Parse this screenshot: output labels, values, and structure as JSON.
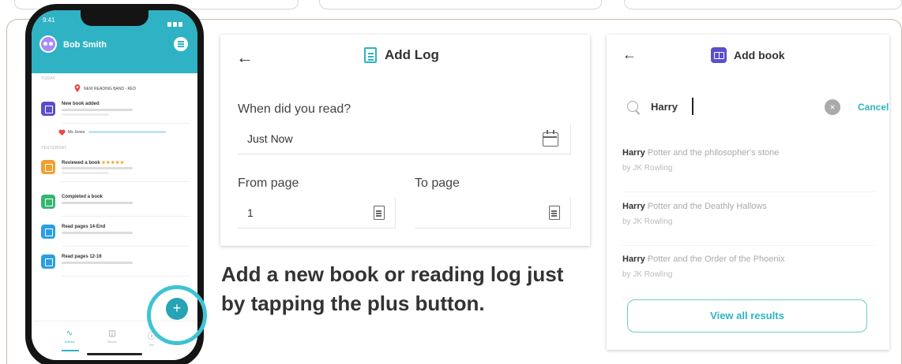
{
  "colors": {
    "teal": "#2fb3c4",
    "purple": "#5b4fc9",
    "fab_ring": "#3fc3d3"
  },
  "phone": {
    "status_time": "9:41",
    "user_name": "Bob Smith",
    "section_today": "TODAY",
    "note_milestone": "NEW READING BAND - RED",
    "items_today": [
      {
        "title": "New book added",
        "icon": "book-icon",
        "color": "#5b4fc9"
      }
    ],
    "note_heart": "Ms Jones",
    "section_yesterday": "YESTERDAY",
    "items_yesterday": [
      {
        "title": "Reviewed a book",
        "stars": "★★★★★",
        "icon": "star-badge-icon",
        "color": "#f0a030"
      },
      {
        "title": "Completed a book",
        "icon": "check-book-icon",
        "color": "#34b870"
      },
      {
        "title": "Read pages 14-End",
        "icon": "page-icon",
        "color": "#2a9fe0"
      },
      {
        "title": "Read pages 12-16",
        "icon": "page-icon",
        "color": "#2a9fe0"
      }
    ],
    "fab_label": "+",
    "tabs": [
      {
        "label": "Activity",
        "glyph": "∿"
      },
      {
        "label": "Books",
        "glyph": "◫"
      },
      {
        "label": "Info",
        "glyph": "ⓘ"
      }
    ]
  },
  "add_log": {
    "title": "Add Log",
    "when_label": "When did you read?",
    "when_value": "Just Now",
    "from_label": "From page",
    "from_value": "1",
    "to_label": "To page",
    "to_value": ""
  },
  "caption": "Add a new book or reading log just by tapping the plus button.",
  "add_book": {
    "title": "Add book",
    "search_value": "Harry",
    "cancel_label": "Cancel",
    "results": [
      {
        "match": "Harry",
        "rest": " Potter and the philosopher's stone",
        "author": "by JK Rowling"
      },
      {
        "match": "Harry",
        "rest": " Potter and the Deathly Hallows",
        "author": "by JK Rowling"
      },
      {
        "match": "Harry",
        "rest": " Potter and the Order of the Phoenix",
        "author": "by JK Rowling"
      }
    ],
    "view_all_label": "View all results"
  }
}
